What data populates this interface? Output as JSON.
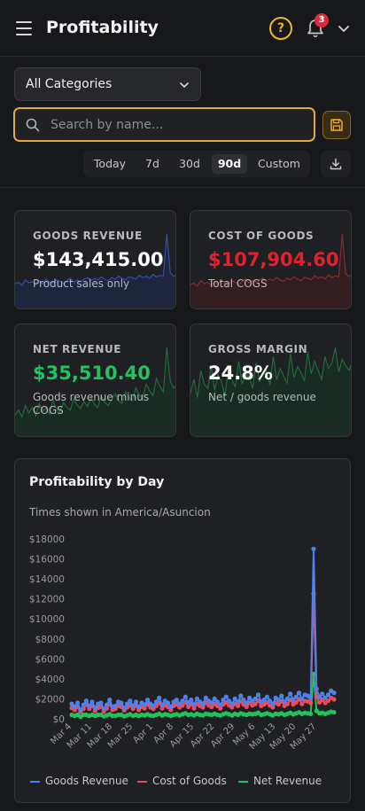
{
  "header": {
    "title": "Profitability",
    "help_glyph": "?",
    "notification_count": "3"
  },
  "filters": {
    "category_select": "All Categories",
    "search_placeholder": "Search by name...",
    "ranges": [
      "Today",
      "7d",
      "30d",
      "90d",
      "Custom"
    ],
    "active_range": "90d"
  },
  "colors": {
    "accent": "#e3aa3b",
    "goods": "#4b82f0",
    "cost": "#ef4a55",
    "net": "#22c25e",
    "badge": "#e02a3a"
  },
  "icons": {
    "menu": "menu-icon",
    "help": "help-icon",
    "bell": "bell-icon",
    "chevron": "chevron-down-icon",
    "search": "search-icon",
    "save": "save-icon",
    "download": "download-icon"
  },
  "cards": [
    {
      "label": "GOODS REVENUE",
      "value": "$143,415.00",
      "sub": "Product sales only",
      "value_color": "#ffffff",
      "line": "#2f4fa8",
      "fill": "#1e2a4a"
    },
    {
      "label": "COST OF GOODS",
      "value": "$107,904.60",
      "sub": "Total COGS",
      "value_color": "#e0222e",
      "line": "#8a2a30",
      "fill": "#3a1c20"
    },
    {
      "label": "NET REVENUE",
      "value": "$35,510.40",
      "sub": "Goods revenue minus COGS",
      "value_color": "#22c25e",
      "line": "#1f6a3e",
      "fill": "#173024"
    },
    {
      "label": "GROSS MARGIN",
      "value": "24.8%",
      "sub": "Net / goods revenue",
      "value_color": "#ffffff",
      "line": "#1f6a3e",
      "fill": "#173024"
    }
  ],
  "chart_card": {
    "title": "Profitability by Day",
    "timezone_note": "Times shown in America/Asuncion"
  },
  "chart_data": {
    "type": "line",
    "title": "Profitability by Day",
    "x": [
      "Mar 4",
      "Mar 5",
      "Mar 6",
      "Mar 7",
      "Mar 8",
      "Mar 9",
      "Mar 10",
      "Mar 11",
      "Mar 12",
      "Mar 13",
      "Mar 14",
      "Mar 15",
      "Mar 16",
      "Mar 17",
      "Mar 18",
      "Mar 19",
      "Mar 20",
      "Mar 21",
      "Mar 22",
      "Mar 23",
      "Mar 24",
      "Mar 25",
      "Mar 26",
      "Mar 27",
      "Mar 28",
      "Mar 29",
      "Mar 30",
      "Mar 31",
      "Apr 1",
      "Apr 2",
      "Apr 3",
      "Apr 4",
      "Apr 5",
      "Apr 6",
      "Apr 7",
      "Apr 8",
      "Apr 9",
      "Apr 10",
      "Apr 11",
      "Apr 12",
      "Apr 13",
      "Apr 14",
      "Apr 15",
      "Apr 16",
      "Apr 17",
      "Apr 18",
      "Apr 19",
      "Apr 20",
      "Apr 21",
      "Apr 22",
      "Apr 23",
      "Apr 24",
      "Apr 25",
      "Apr 26",
      "Apr 27",
      "Apr 28",
      "Apr 29",
      "Apr 30",
      "May 1",
      "May 2",
      "May 3",
      "May 4",
      "May 5",
      "May 6",
      "May 7",
      "May 8",
      "May 9",
      "May 10",
      "May 11",
      "May 12",
      "May 13",
      "May 14",
      "May 15",
      "May 16",
      "May 17",
      "May 18",
      "May 19",
      "May 20",
      "May 21",
      "May 22",
      "May 23",
      "May 24",
      "May 25",
      "May 26",
      "May 27",
      "May 28",
      "May 29",
      "May 30",
      "May 31",
      "Jun 1",
      "Jun 2"
    ],
    "x_tick_labels": [
      "Mar 4",
      "Mar 11",
      "Mar 18",
      "Mar 25",
      "Apr 1",
      "Apr 8",
      "Apr 15",
      "Apr 22",
      "Apr 29",
      "May 6",
      "May 13",
      "May 20",
      "May 27"
    ],
    "y_ticks": [
      "$0",
      "$2000",
      "$4000",
      "$6000",
      "$8000",
      "$10000",
      "$12000",
      "$14000",
      "$16000",
      "$18000"
    ],
    "ylim": [
      0,
      18000
    ],
    "grid": false,
    "legend_position": "bottom",
    "series": [
      {
        "name": "Goods Revenue",
        "color": "#4b82f0",
        "values": [
          1500,
          1200,
          1600,
          900,
          1400,
          1800,
          1300,
          1700,
          1100,
          1500,
          1600,
          1000,
          1400,
          1900,
          1200,
          1300,
          1700,
          1600,
          1100,
          1500,
          1800,
          1300,
          1700,
          1200,
          1600,
          1400,
          1900,
          1500,
          1300,
          1700,
          2100,
          1400,
          1800,
          1600,
          1200,
          1700,
          1900,
          1500,
          1800,
          2200,
          1600,
          1900,
          1400,
          2000,
          1700,
          1500,
          2100,
          1800,
          1600,
          2000,
          1700,
          1400,
          1900,
          2200,
          1800,
          1500,
          2000,
          1700,
          2300,
          1900,
          1600,
          2100,
          1800,
          2000,
          2400,
          1700,
          1900,
          2200,
          1800,
          1500,
          2100,
          1900,
          2300,
          1700,
          2000,
          2500,
          1900,
          2200,
          2600,
          2000,
          2400,
          2300,
          2100,
          17000,
          3000,
          2200,
          2500,
          2100,
          2400,
          2800,
          2600
        ]
      },
      {
        "name": "Cost of Goods",
        "color": "#ef4a55",
        "values": [
          1100,
          900,
          1200,
          700,
          1000,
          1400,
          1000,
          1300,
          800,
          1100,
          1200,
          750,
          1050,
          1450,
          900,
          1000,
          1300,
          1200,
          850,
          1150,
          1350,
          1000,
          1300,
          900,
          1200,
          1050,
          1450,
          1150,
          1000,
          1300,
          1600,
          1050,
          1350,
          1200,
          900,
          1300,
          1450,
          1150,
          1350,
          1650,
          1200,
          1450,
          1050,
          1500,
          1300,
          1150,
          1600,
          1350,
          1200,
          1500,
          1300,
          1050,
          1450,
          1650,
          1350,
          1150,
          1500,
          1300,
          1750,
          1450,
          1200,
          1600,
          1350,
          1500,
          1800,
          1300,
          1450,
          1650,
          1350,
          1150,
          1600,
          1450,
          1750,
          1300,
          1500,
          1900,
          1450,
          1650,
          1950,
          1500,
          1800,
          1750,
          1600,
          12500,
          2200,
          1650,
          1900,
          1600,
          1800,
          2100,
          1950
        ]
      },
      {
        "name": "Net Revenue",
        "color": "#22c25e",
        "values": [
          400,
          300,
          400,
          200,
          400,
          400,
          300,
          400,
          300,
          400,
          400,
          250,
          350,
          450,
          300,
          300,
          400,
          400,
          250,
          350,
          450,
          300,
          400,
          300,
          400,
          350,
          450,
          350,
          300,
          400,
          500,
          350,
          450,
          400,
          300,
          400,
          450,
          350,
          450,
          550,
          400,
          450,
          350,
          500,
          400,
          350,
          500,
          450,
          400,
          500,
          400,
          350,
          450,
          550,
          450,
          350,
          500,
          400,
          550,
          450,
          400,
          500,
          450,
          500,
          600,
          400,
          450,
          550,
          450,
          350,
          500,
          450,
          550,
          400,
          500,
          600,
          450,
          550,
          650,
          500,
          600,
          550,
          500,
          4500,
          800,
          550,
          600,
          500,
          600,
          700,
          650
        ]
      }
    ]
  },
  "sparks": {
    "goods": [
      30,
      32,
      28,
      35,
      31,
      33,
      29,
      34,
      30,
      36,
      32,
      31,
      35,
      33,
      30,
      34,
      37,
      32,
      35,
      33,
      36,
      38,
      34,
      37,
      35,
      39,
      36,
      34,
      38,
      36,
      40,
      37,
      35,
      39,
      38,
      36,
      41,
      38,
      40,
      37,
      42,
      39,
      41,
      40,
      95,
      44,
      40,
      42
    ],
    "cost": [
      28,
      30,
      26,
      33,
      29,
      31,
      27,
      32,
      28,
      34,
      30,
      29,
      33,
      31,
      28,
      32,
      35,
      30,
      33,
      31,
      34,
      36,
      32,
      35,
      33,
      37,
      34,
      32,
      36,
      34,
      38,
      35,
      33,
      37,
      36,
      34,
      39,
      36,
      38,
      35,
      40,
      37,
      39,
      38,
      92,
      42,
      38,
      40
    ],
    "net": [
      20,
      25,
      18,
      30,
      22,
      28,
      19,
      32,
      24,
      27,
      21,
      35,
      26,
      23,
      33,
      28,
      25,
      37,
      30,
      27,
      34,
      29,
      38,
      31,
      28,
      40,
      33,
      30,
      36,
      42,
      35,
      32,
      44,
      38,
      35,
      48,
      41,
      37,
      52,
      45,
      40,
      58,
      50,
      44,
      90,
      55,
      48,
      52
    ],
    "margin": [
      45,
      60,
      40,
      70,
      55,
      50,
      75,
      48,
      65,
      58,
      42,
      72,
      60,
      52,
      80,
      55,
      68,
      62,
      50,
      78,
      58,
      66,
      70,
      54,
      85,
      60,
      72,
      64,
      56,
      88,
      62,
      74,
      68,
      58,
      90,
      66,
      80,
      70,
      60,
      85,
      72,
      78,
      95,
      68,
      82,
      75,
      70,
      80
    ]
  }
}
